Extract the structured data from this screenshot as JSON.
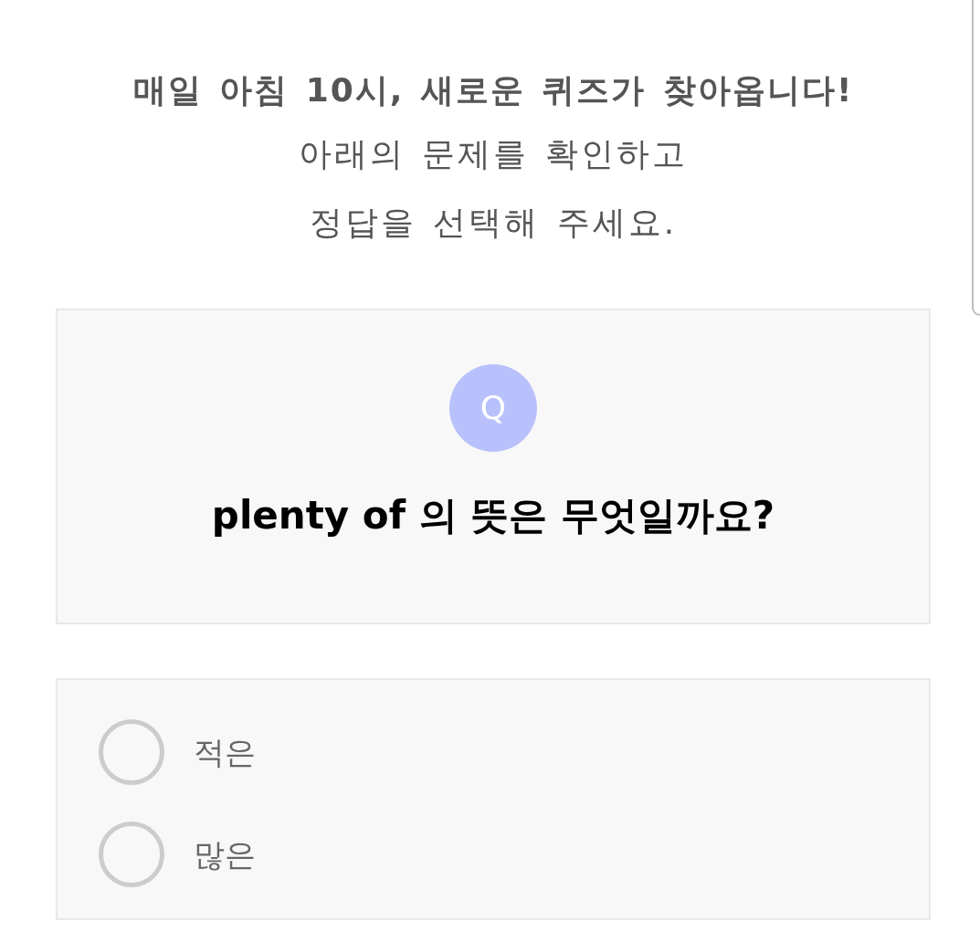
{
  "intro": {
    "headline": "매일 아침 10시, 새로운 퀴즈가 찾아옵니다!",
    "lines": [
      "아래의 문제를 확인하고",
      "정답을 선택해 주세요."
    ]
  },
  "question": {
    "badge": "Q",
    "text": "plenty of 의 뜻은 무엇일까요?"
  },
  "options": [
    {
      "label": "적은",
      "selected": false
    },
    {
      "label": "많은",
      "selected": false
    }
  ]
}
